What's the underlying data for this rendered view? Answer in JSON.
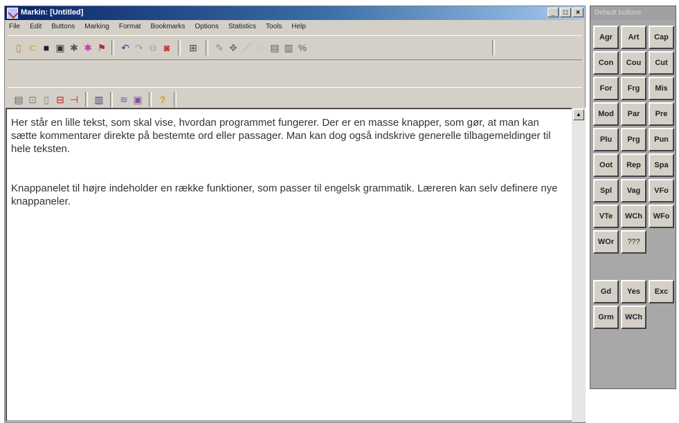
{
  "window": {
    "title": "Markin: [Untitled]",
    "controls": [
      "_",
      "□",
      "×"
    ]
  },
  "menu": [
    "File",
    "Edit",
    "Buttons",
    "Marking",
    "Format",
    "Bookmarks",
    "Options",
    "Statistics",
    "Tools",
    "Help"
  ],
  "toolbar1_icons": [
    "new-icon",
    "open-icon",
    "save-icon",
    "save-all-icon",
    "tool5-icon",
    "tool6-icon",
    "tool7-icon",
    "undo-icon",
    "redo-icon",
    "copy-icon",
    "find-icon",
    "grid-icon",
    "pen-icon",
    "marker-icon",
    "pencil-icon",
    "eraser-icon",
    "box1-icon",
    "box2-icon",
    "percent-icon"
  ],
  "editor": {
    "paragraph1": "Her står en lille tekst, som skal vise, hvordan programmet fungerer. Der er en masse knapper, som gør, at man kan sætte kommentarer direkte på bestemte ord eller passager. Man kan dog også indskrive generelle tilbagemeldinger til hele teksten.",
    "paragraph2": "Knappanelet til højre indeholder en række funktioner, som passer til engelsk grammatik. Læreren kan selv definere nye knappaneler."
  },
  "panel": {
    "title": "Default buttons",
    "buttons": [
      "Agr",
      "Art",
      "Cap",
      "Con",
      "Cou",
      "Cut",
      "For",
      "Frg",
      "Mis",
      "Mod",
      "Par",
      "Pre",
      "Plu",
      "Prg",
      "Pun",
      "Oot",
      "Rep",
      "Spa",
      "Spl",
      "Vag",
      "VFo",
      "VTe",
      "WCh",
      "WFo",
      "WOr",
      "???"
    ],
    "buttons2": [
      "Gd",
      "Yes",
      "Exc",
      "Grm",
      "WCh"
    ]
  },
  "colors": {
    "titlebar": "#0a246a",
    "face": "#d4d0c8",
    "accent": "#b0302a"
  }
}
